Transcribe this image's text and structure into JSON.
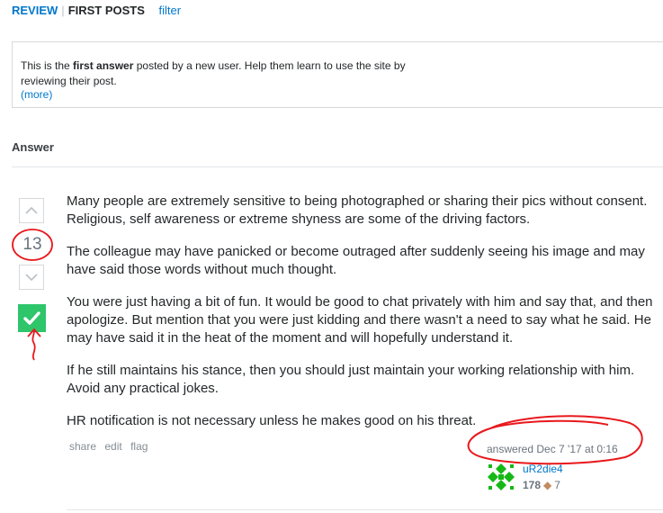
{
  "review_nav": {
    "review": "REVIEW",
    "separator": "|",
    "first_posts": "FIRST POSTS",
    "filter": "filter"
  },
  "info": {
    "text_before": "This is the ",
    "text_bold": "first answer",
    "text_after": " posted by a new user. Help them learn to use the site by reviewing their post.",
    "more": "(more)"
  },
  "answer": {
    "heading": "Answer",
    "vote_count": "13",
    "paragraphs": [
      "Many people are extremely sensitive to being photographed or sharing their pics without consent. Religious, self awareness or extreme shyness are some of the driving factors.",
      "The colleague may have panicked or become outraged after suddenly seeing his image and may have said those words without much thought.",
      "You were just having a bit of fun. It would be good to chat privately with him and say that, and then apologize. But mention that you were just kidding and there wasn't a need to say what he said. He may have said it in the heat of the moment and will hopefully understand it.",
      "If he still maintains his stance, then you should just maintain your working relationship with him. Avoid any practical jokes.",
      "HR notification is not necessary unless he makes good on his threat."
    ],
    "menu": {
      "share": "share",
      "edit": "edit",
      "flag": "flag"
    },
    "answered_time": "answered Dec 7 '17 at 0:16",
    "user": {
      "name": "uR2die4",
      "reputation": "178",
      "bronze_dot": "◆",
      "bronze_badges": "7"
    }
  },
  "colors": {
    "link": "#0077cc",
    "accepted": "#2ec56b",
    "annotation": "#e8181c",
    "avatar": "#16b816"
  }
}
